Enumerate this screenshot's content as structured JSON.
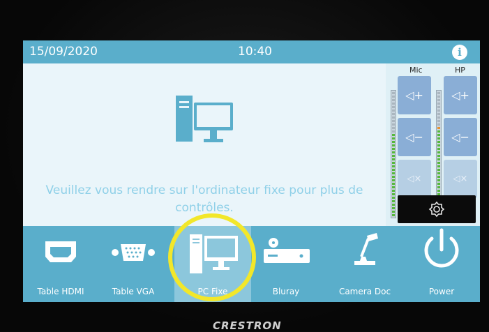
{
  "header": {
    "date": "15/09/2020",
    "time": "10:40",
    "info_icon": "info-icon"
  },
  "main": {
    "message_line1": "Veuillez vous rendre sur l'ordinateur fixe pour plus de",
    "message_line2": "contrôles.",
    "icon": "desktop-computer-icon"
  },
  "audio": {
    "mic_label": "Mic",
    "hp_label": "HP",
    "vol_up": "◁+",
    "vol_down": "◁−",
    "mute": "◁×"
  },
  "sources": [
    {
      "label": "Table HDMI",
      "icon": "hdmi-icon",
      "active": false
    },
    {
      "label": "Table VGA",
      "icon": "vga-icon",
      "active": false
    },
    {
      "label": "PC Fixe",
      "icon": "desktop-computer-icon",
      "active": true
    },
    {
      "label": "Bluray",
      "icon": "bluray-player-icon",
      "active": false
    },
    {
      "label": "Camera Doc",
      "icon": "document-camera-icon",
      "active": false
    },
    {
      "label": "Power",
      "icon": "power-icon",
      "active": false
    }
  ],
  "brand": "CRESTRON",
  "colors": {
    "bar": "#5aaecb",
    "content": "#eaf5fa",
    "highlight": "#f2e72a",
    "volume_button": "#8aaed6"
  }
}
